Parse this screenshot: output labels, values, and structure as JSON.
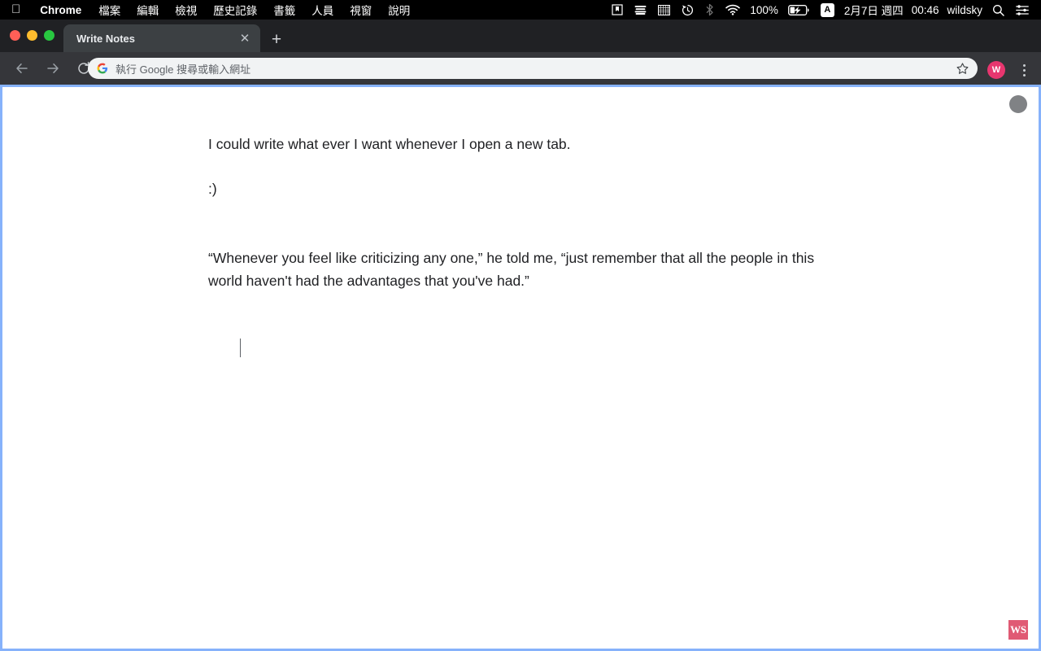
{
  "menubar": {
    "apple_icon": "apple-logo",
    "app_name": "Chrome",
    "items": [
      "檔案",
      "編輯",
      "檢視",
      "歷史記錄",
      "書籤",
      "人員",
      "視窗",
      "說明"
    ],
    "status_icons": [
      "bookmark-box-icon",
      "layers-icon",
      "grid-icon",
      "time-machine-icon",
      "bluetooth-icon",
      "wifi-icon"
    ],
    "battery_percent": "100%",
    "battery_icon": "battery-charging-icon",
    "input_source": "A",
    "date": "2月7日 週四",
    "time": "00:46",
    "user": "wildsky",
    "search_icon": "search-icon",
    "control_center_icon": "control-center-icon"
  },
  "browser": {
    "tabs": [
      {
        "title": "Write Notes",
        "close_label": "✕",
        "active": true
      }
    ],
    "new_tab_label": "+",
    "nav": {
      "back_label": "←",
      "forward_label": "→",
      "reload_label": "⟳"
    },
    "omnibox": {
      "placeholder": "執行 Google 搜尋或輸入網址",
      "value": "",
      "favicon": "google-g-icon",
      "bookmark_icon": "star-icon"
    },
    "profile": {
      "initial": "W",
      "color": "#e8366f"
    },
    "menu_icon": "three-dot-menu-icon"
  },
  "page": {
    "paragraphs": [
      "I could write what ever I want whenever I open a new tab.",
      ":)",
      "“Whenever you feel like criticizing any one,” he told me, “just remember that all the people in this world haven't had the advantages that you've had.”"
    ],
    "avatar_icon": "user-avatar-circle",
    "watermark": "WS",
    "watermark_color": "#e05a74",
    "focus_ring_color": "#86b2fb"
  }
}
